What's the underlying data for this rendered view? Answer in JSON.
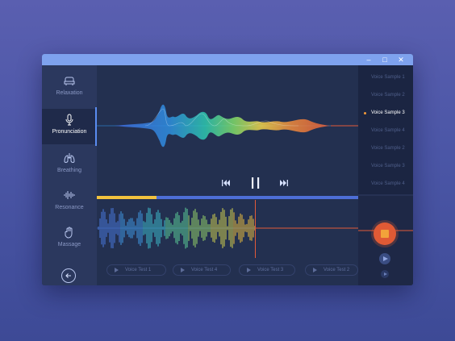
{
  "window": {
    "controls": [
      "minimize",
      "maximize",
      "close"
    ],
    "minimize_glyph": "–",
    "maximize_glyph": "□",
    "close_glyph": "✕"
  },
  "sidebar": {
    "items": [
      {
        "label": "Relaxation",
        "icon": "armchair-icon",
        "active": false
      },
      {
        "label": "Pronunciation",
        "icon": "microphone-icon",
        "active": true
      },
      {
        "label": "Breathing",
        "icon": "lungs-icon",
        "active": false
      },
      {
        "label": "Resonance",
        "icon": "sound-wave-icon",
        "active": false
      },
      {
        "label": "Massage",
        "icon": "hand-icon",
        "active": false
      }
    ],
    "back_icon": "arrow-left-circle-icon"
  },
  "playlist": {
    "items": [
      {
        "label": "Voice Sample 1",
        "active": false
      },
      {
        "label": "Voice Sample 2",
        "active": false
      },
      {
        "label": "Voice Sample 3",
        "active": true
      },
      {
        "label": "Voice Sample 4",
        "active": false
      },
      {
        "label": "Voice Sample 2",
        "active": false
      },
      {
        "label": "Voice Sample 3",
        "active": false
      },
      {
        "label": "Voice Sample 4",
        "active": false
      }
    ]
  },
  "player": {
    "progress": 0.19,
    "controls": [
      "skip-back-icon",
      "pause-icon",
      "skip-forward-icon"
    ]
  },
  "recording": {
    "playhead_fraction": 0.61
  },
  "voice_tests": [
    {
      "label": "Voice Test 1"
    },
    {
      "label": "Voice Test 4"
    },
    {
      "label": "Voice Test 3"
    },
    {
      "label": "Voice Test 2"
    }
  ],
  "colors": {
    "accent": "#7ea2ee",
    "record": "#e05a35",
    "progress": "#f2c23e",
    "active_dot": "#f39a3a"
  }
}
